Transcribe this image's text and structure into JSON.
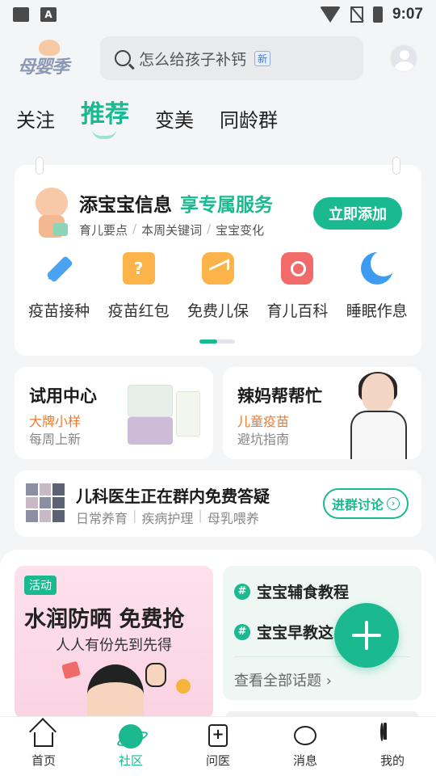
{
  "status_bar": {
    "time": "9:07",
    "a_icon": "A"
  },
  "header": {
    "logo_text": "母婴季",
    "search_query": "怎么给孩子补钙",
    "search_badge": "新"
  },
  "tabs": [
    {
      "label": "关注"
    },
    {
      "label": "推荐"
    },
    {
      "label": "变美"
    },
    {
      "label": "同龄群"
    }
  ],
  "baby_card": {
    "title_main": "添宝宝信息",
    "title_accent": "享专属服务",
    "sub_items": [
      "育儿要点",
      "本周关键词",
      "宝宝变化"
    ],
    "add_button": "立即添加",
    "shortcuts": [
      {
        "label": "疫苗接种",
        "icon": "syringe-icon"
      },
      {
        "label": "疫苗红包",
        "icon": "gift-icon"
      },
      {
        "label": "免费儿保",
        "icon": "trend-chart-icon"
      },
      {
        "label": "育儿百科",
        "icon": "book-search-icon"
      },
      {
        "label": "睡眠作息",
        "icon": "moon-icon"
      }
    ]
  },
  "trial_card": {
    "title": "试用中心",
    "highlight": "大牌小样",
    "sub": "每周上新"
  },
  "mom_card": {
    "title": "辣妈帮帮忙",
    "highlight": "儿童疫苗",
    "sub": "避坑指南"
  },
  "doctor_row": {
    "title": "儿科医生正在群内免费答疑",
    "tags": [
      "日常养育",
      "疾病护理",
      "母乳喂养"
    ],
    "button": "进群讨论",
    "arrow": "›"
  },
  "promo": {
    "tag": "活动",
    "title": "水润防晒 免费抢",
    "subtitle": "人人有份先到先得"
  },
  "topics": {
    "items": [
      "宝宝辅食教程",
      "宝宝早教这"
    ],
    "hash_symbol": "#",
    "see_all": "查看全部话题 ›"
  },
  "bottom_nav": [
    {
      "label": "首页",
      "icon": "home-icon"
    },
    {
      "label": "社区",
      "icon": "community-icon"
    },
    {
      "label": "问医",
      "icon": "medical-kit-icon"
    },
    {
      "label": "消息",
      "icon": "chat-bubble-icon"
    },
    {
      "label": "我的",
      "icon": "person-icon"
    }
  ],
  "colors": {
    "accent": "#1bb98f",
    "highlight_orange": "#ee7a2e",
    "background": "#f4f5f7"
  }
}
